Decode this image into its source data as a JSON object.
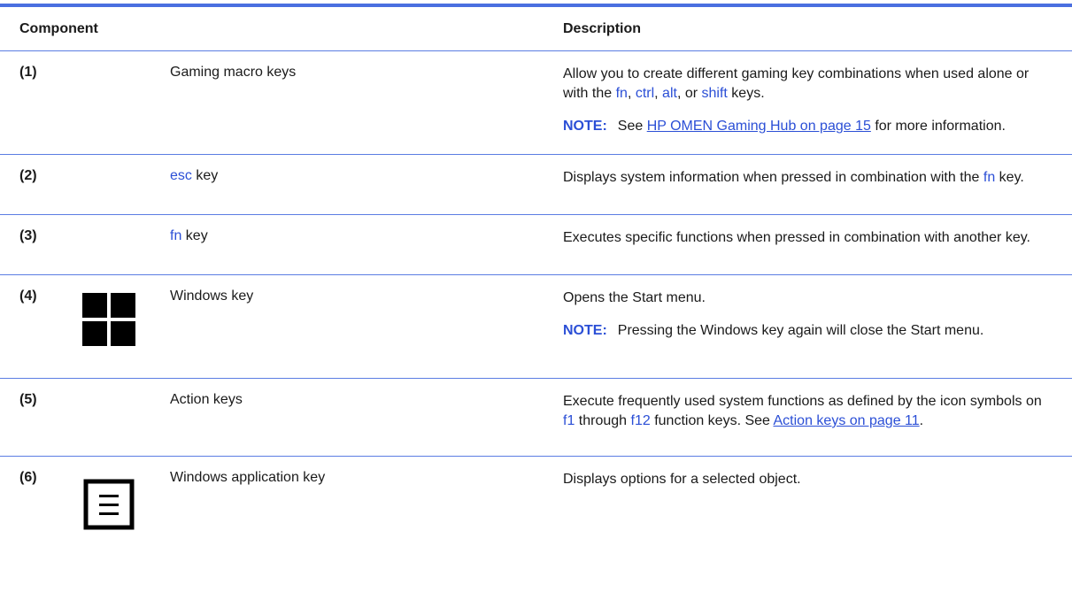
{
  "header": {
    "component": "Component",
    "description": "Description"
  },
  "rows": [
    {
      "num": "(1)",
      "name": "Gaming macro keys",
      "desc": {
        "t1": "Allow you to create different gaming key combinations when used alone or with the ",
        "k_fn": "fn",
        "s1": ", ",
        "k_ctrl": "ctrl",
        "s2": ", ",
        "k_alt": "alt",
        "s3": ", or ",
        "k_shift": "shift",
        "s4": " keys."
      },
      "note": {
        "label": "NOTE:",
        "pre": "See ",
        "link": "HP OMEN Gaming Hub on page 15",
        "post": " for more information."
      }
    },
    {
      "num": "(2)",
      "name_kw": "esc",
      "name_rest": " key",
      "desc": {
        "t1": "Displays system information when pressed in combination with the ",
        "k_fn": "fn",
        "t2": " key."
      }
    },
    {
      "num": "(3)",
      "name_kw": "fn",
      "name_rest": " key",
      "desc": {
        "t1": "Executes specific functions when pressed in combination with another key."
      }
    },
    {
      "num": "(4)",
      "icon": "windows-logo-icon",
      "name": "Windows key",
      "desc": {
        "t1": "Opens the Start menu."
      },
      "note": {
        "label": "NOTE:",
        "text": "Pressing the Windows key again will close the Start menu."
      }
    },
    {
      "num": "(5)",
      "name": "Action keys",
      "desc": {
        "t1": "Execute frequently used system functions as defined by the icon symbols on ",
        "k_f1": "f1",
        "t2": " through ",
        "k_f12": "f12",
        "t3": " function keys. See ",
        "link": "Action keys on page 11",
        "t4": "."
      }
    },
    {
      "num": "(6)",
      "icon": "application-menu-icon",
      "name": "Windows application key",
      "desc": {
        "t1": "Displays options for a selected object."
      }
    }
  ],
  "colors": {
    "accent": "#2b4fd6",
    "rule": "#5b7de3",
    "top_border": "#4a6fe0"
  }
}
